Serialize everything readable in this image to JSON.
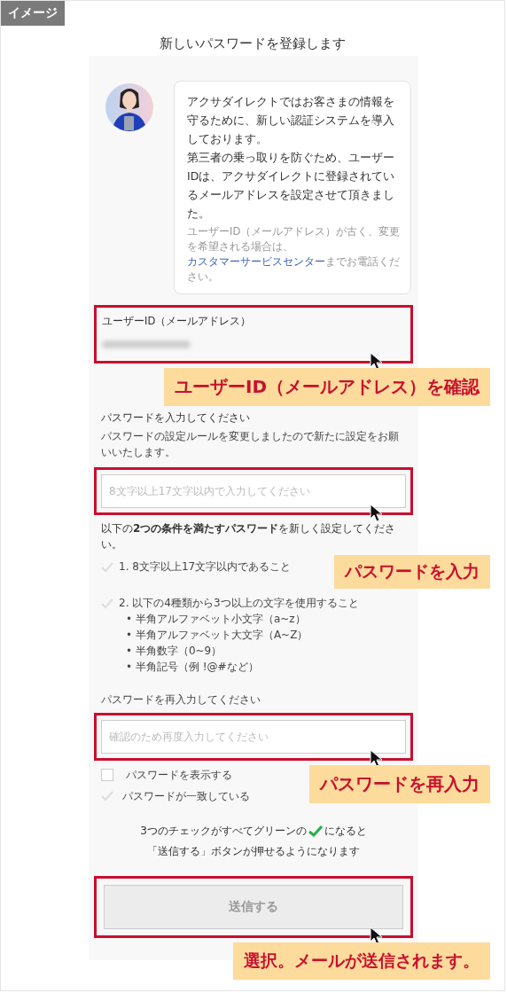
{
  "badge": "イメージ",
  "title": "新しいパスワードを登録します",
  "intro": {
    "paragraphs": [
      "アクサダイレクトではお客さまの情報を守るために、新しい認証システムを導入しております。",
      "第三者の乗っ取りを防ぐため、ユーザーIDは、アクサダイレクトに登録されているメールアドレスを設定させて頂きました。"
    ],
    "note_before": "ユーザーID（メールアドレス）が古く、変更を希望される場合は、",
    "note_link": "カスタマーサービスセンター",
    "note_after": "までお電話ください。"
  },
  "user_id": {
    "label": "ユーザーID（メールアドレス）"
  },
  "password": {
    "label": "パスワードを入力してください",
    "description": "パスワードの設定ルールを変更しましたので新たに設定をお願いいたします。",
    "placeholder": "8文字以上17文字以内で入力してください"
  },
  "rules_intro": "以下の**2つの条件を満たすパスワード**を新しく設定してください。",
  "rules": [
    {
      "text": "1. 8文字以上17文字以内であること",
      "met": false
    },
    {
      "text": "2. 以下の4種類から3つ以上の文字を使用すること",
      "met": false,
      "sub_items": [
        "• 半角アルファベット小文字（a~z）",
        "• 半角アルファベット大文字（A~Z）",
        "• 半角数字（0~9）",
        "• 半角記号（例 !@#など）"
      ]
    }
  ],
  "confirm": {
    "label": "パスワードを再入力してください",
    "placeholder": "確認のため再度入力してください"
  },
  "show_password": {
    "label": "パスワードを表示する",
    "checked": false
  },
  "match": {
    "label": "パスワードが一致している",
    "met": false
  },
  "note": {
    "before": "3つのチェックがすべてグリーンの",
    "after": "になると",
    "line2": "「送信する」ボタンが押せるようになります"
  },
  "submit": {
    "label": "送信する",
    "disabled": true
  },
  "callouts": [
    "ユーザーID（メールアドレス）を確認",
    "パスワードを入力",
    "パスワードを再入力",
    "選択。メールが送信されます。"
  ]
}
